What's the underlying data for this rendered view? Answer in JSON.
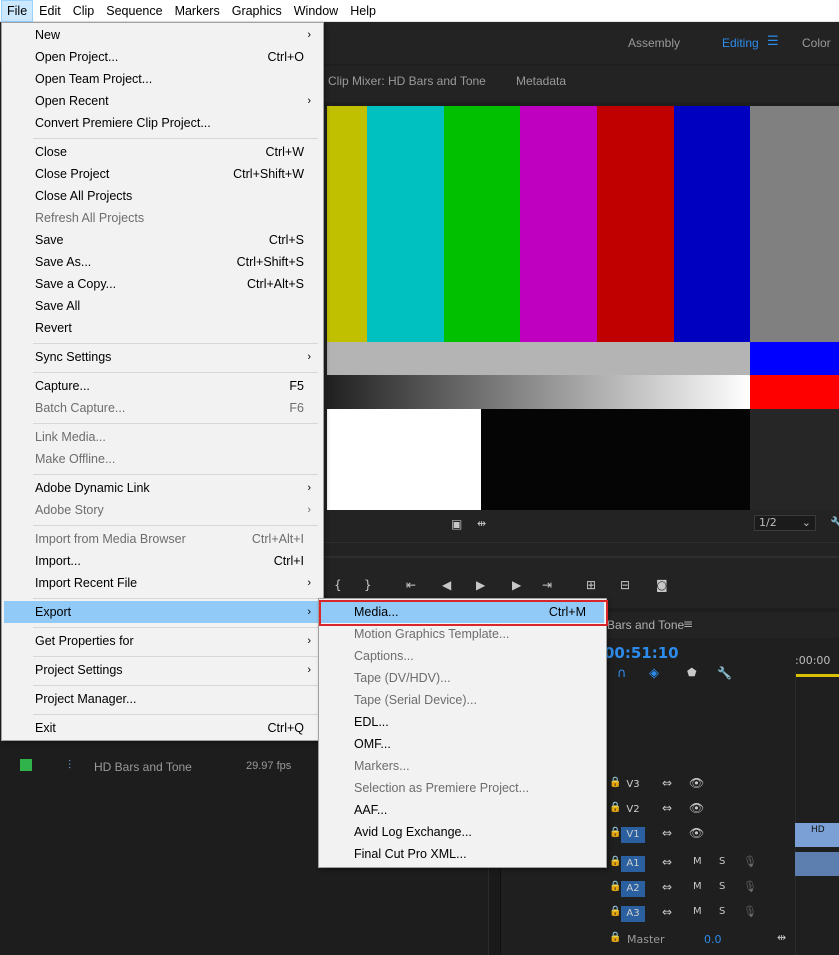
{
  "menubar": {
    "items": [
      "File",
      "Edit",
      "Clip",
      "Sequence",
      "Markers",
      "Graphics",
      "Window",
      "Help"
    ]
  },
  "workspaces": {
    "assembly": "Assembly",
    "editing": "Editing",
    "color": "Color"
  },
  "panel_tabs": {
    "clip_mixer": "Clip Mixer: HD Bars and Tone",
    "metadata": "Metadata"
  },
  "monitor": {
    "resolution": "1/2",
    "bar_colors": [
      "#c0c000",
      "#00c0c0",
      "#00c000",
      "#c000c0",
      "#c00000",
      "#0000c0",
      "#808080"
    ]
  },
  "sequence": {
    "tab_name": "Bars and Tone",
    "timecode": "00:51:10",
    "ruler_start": ":00:00",
    "tracks": [
      "V3",
      "V2",
      "V1",
      "A1",
      "A2",
      "A3"
    ],
    "master_label": "Master",
    "master_value": "0.0",
    "clip_label": "HD"
  },
  "project": {
    "item_name": "HD Bars and Tone",
    "item_fps": "29.97 fps"
  },
  "file_menu": [
    {
      "label": "New",
      "shortcut": "",
      "submenu": true,
      "disabled": false
    },
    {
      "label": "Open Project...",
      "shortcut": "Ctrl+O",
      "submenu": false,
      "disabled": false
    },
    {
      "label": "Open Team Project...",
      "shortcut": "",
      "submenu": false,
      "disabled": false
    },
    {
      "label": "Open Recent",
      "shortcut": "",
      "submenu": true,
      "disabled": false
    },
    {
      "label": "Convert Premiere Clip Project...",
      "shortcut": "",
      "submenu": false,
      "disabled": false
    },
    {
      "label": "Close",
      "shortcut": "Ctrl+W",
      "submenu": false,
      "disabled": false
    },
    {
      "label": "Close Project",
      "shortcut": "Ctrl+Shift+W",
      "submenu": false,
      "disabled": false
    },
    {
      "label": "Close All Projects",
      "shortcut": "",
      "submenu": false,
      "disabled": false
    },
    {
      "label": "Refresh All Projects",
      "shortcut": "",
      "submenu": false,
      "disabled": true
    },
    {
      "label": "Save",
      "shortcut": "Ctrl+S",
      "submenu": false,
      "disabled": false
    },
    {
      "label": "Save As...",
      "shortcut": "Ctrl+Shift+S",
      "submenu": false,
      "disabled": false
    },
    {
      "label": "Save a Copy...",
      "shortcut": "Ctrl+Alt+S",
      "submenu": false,
      "disabled": false
    },
    {
      "label": "Save All",
      "shortcut": "",
      "submenu": false,
      "disabled": false
    },
    {
      "label": "Revert",
      "shortcut": "",
      "submenu": false,
      "disabled": false
    },
    {
      "label": "Sync Settings",
      "shortcut": "",
      "submenu": true,
      "disabled": false
    },
    {
      "label": "Capture...",
      "shortcut": "F5",
      "submenu": false,
      "disabled": false
    },
    {
      "label": "Batch Capture...",
      "shortcut": "F6",
      "submenu": false,
      "disabled": true
    },
    {
      "label": "Link Media...",
      "shortcut": "",
      "submenu": false,
      "disabled": true
    },
    {
      "label": "Make Offline...",
      "shortcut": "",
      "submenu": false,
      "disabled": true
    },
    {
      "label": "Adobe Dynamic Link",
      "shortcut": "",
      "submenu": true,
      "disabled": false
    },
    {
      "label": "Adobe Story",
      "shortcut": "",
      "submenu": true,
      "disabled": true
    },
    {
      "label": "Import from Media Browser",
      "shortcut": "Ctrl+Alt+I",
      "submenu": false,
      "disabled": true
    },
    {
      "label": "Import...",
      "shortcut": "Ctrl+I",
      "submenu": false,
      "disabled": false
    },
    {
      "label": "Import Recent File",
      "shortcut": "",
      "submenu": true,
      "disabled": false
    },
    {
      "label": "Export",
      "shortcut": "",
      "submenu": true,
      "disabled": false,
      "highlighted": true
    },
    {
      "label": "Get Properties for",
      "shortcut": "",
      "submenu": true,
      "disabled": false
    },
    {
      "label": "Project Settings",
      "shortcut": "",
      "submenu": true,
      "disabled": false
    },
    {
      "label": "Project Manager...",
      "shortcut": "",
      "submenu": false,
      "disabled": false
    },
    {
      "label": "Exit",
      "shortcut": "Ctrl+Q",
      "submenu": false,
      "disabled": false
    }
  ],
  "export_menu": [
    {
      "label": "Media...",
      "shortcut": "Ctrl+M",
      "disabled": false,
      "highlighted": true
    },
    {
      "label": "Motion Graphics Template...",
      "shortcut": "",
      "disabled": true
    },
    {
      "label": "Captions...",
      "shortcut": "",
      "disabled": true
    },
    {
      "label": "Tape (DV/HDV)...",
      "shortcut": "",
      "disabled": true
    },
    {
      "label": "Tape (Serial Device)...",
      "shortcut": "",
      "disabled": true
    },
    {
      "label": "EDL...",
      "shortcut": "",
      "disabled": false
    },
    {
      "label": "OMF...",
      "shortcut": "",
      "disabled": false
    },
    {
      "label": "Markers...",
      "shortcut": "",
      "disabled": true
    },
    {
      "label": "Selection as Premiere Project...",
      "shortcut": "",
      "disabled": true
    },
    {
      "label": "AAF...",
      "shortcut": "",
      "disabled": false
    },
    {
      "label": "Avid Log Exchange...",
      "shortcut": "",
      "disabled": false
    },
    {
      "label": "Final Cut Pro XML...",
      "shortcut": "",
      "disabled": false
    }
  ],
  "colors": {
    "accent_blue": "#2d8ceb",
    "menu_highlight": "#91c9f7",
    "annotation_red": "#d8262b"
  }
}
